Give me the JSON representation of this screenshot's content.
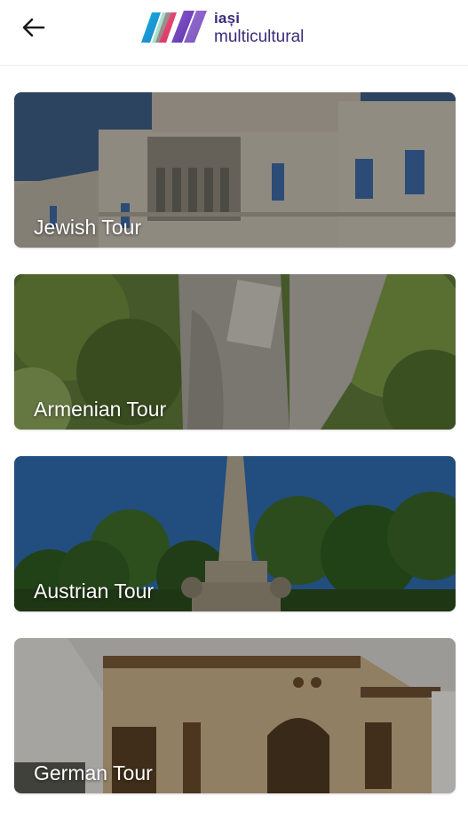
{
  "header": {
    "back_icon": "arrow-left-icon",
    "logo": {
      "line1": "iași",
      "line2": "multicultural",
      "mark_colors": [
        "#1b9fd6",
        "#e63a6f",
        "#7a4ac2"
      ]
    }
  },
  "tours": [
    {
      "label": "Jewish Tour"
    },
    {
      "label": "Armenian Tour"
    },
    {
      "label": "Austrian Tour"
    },
    {
      "label": "German Tour"
    }
  ]
}
